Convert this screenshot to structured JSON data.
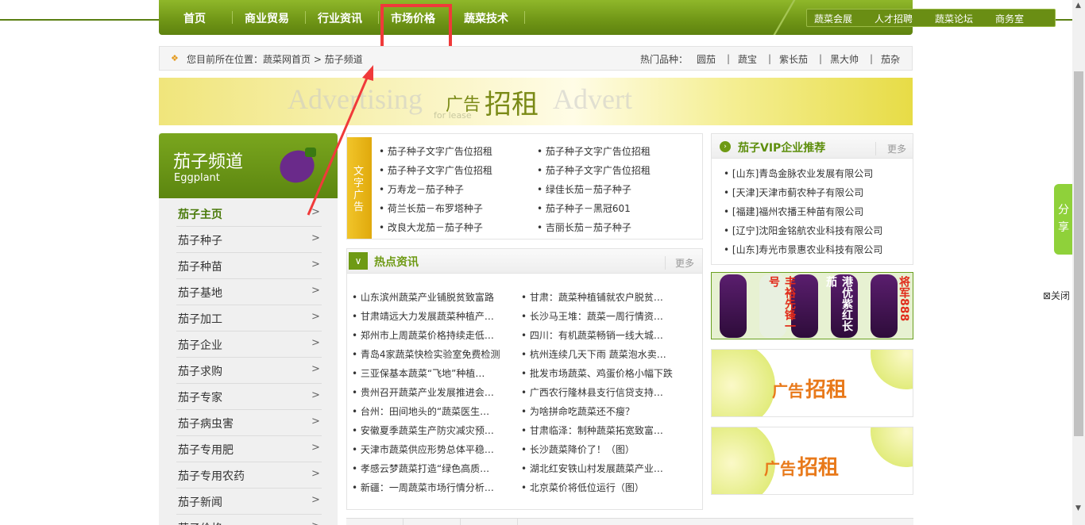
{
  "nav": {
    "items": [
      "首页",
      "商业贸易",
      "行业资讯",
      "市场价格",
      "蔬菜技术"
    ],
    "sub_items": [
      "蔬菜会展",
      "人才招聘",
      "蔬菜论坛",
      "商务室"
    ]
  },
  "breadcrumb": {
    "location": "您目前所在位置：蔬菜网首页 > 茄子频道",
    "hot_label": "热门品种：",
    "hot_varieties": [
      "圆茄",
      "蔬宝",
      "紫长茄",
      "黑大帅",
      "茄杂"
    ]
  },
  "banner": {
    "ghost_left": "Advertising",
    "ghost_right": "Advert",
    "ad_small": "广告",
    "ad_big": "招租",
    "for_lease": "for lease"
  },
  "left_channel": {
    "title": "茄子频道",
    "subtitle": "Eggplant",
    "items": [
      "茄子主页",
      "茄子种子",
      "茄子种苗",
      "茄子基地",
      "茄子加工",
      "茄子企业",
      "茄子求购",
      "茄子专家",
      "茄子病虫害",
      "茄子专用肥",
      "茄子专用农药",
      "茄子新闻",
      "茄子价格"
    ],
    "arrow": ">"
  },
  "text_ads": {
    "tag": "文字广告",
    "left": [
      "茄子种子文字广告位招租",
      "茄子种子文字广告位招租",
      "万寿龙－茄子种子",
      "荷兰长茄－布罗塔种子",
      "改良大龙茄－茄子种子"
    ],
    "right": [
      "茄子种子文字广告位招租",
      "茄子种子文字广告位招租",
      "绿佳长茄－茄子种子",
      "茄子种子－黑冠601",
      "吉丽长茄－茄子种子"
    ]
  },
  "hot_news": {
    "title": "热点资讯",
    "more": "更多",
    "left": [
      "山东滨州蔬菜产业铺脱贫致富路",
      "甘肃靖远大力发展蔬菜种植产…",
      "郑州市上周蔬菜价格持续走低…",
      "青岛4家蔬菜快检实验室免费检测",
      "三亚保基本蔬菜“飞地”种植…",
      "贵州召开蔬菜产业发展推进会…",
      "台州：田间地头的“蔬菜医生…",
      "安徽夏季蔬菜生产防灾减灾预…",
      "天津市蔬菜供应形势总体平稳…",
      "孝感云梦蔬菜打造“绿色高质…",
      "新疆：一周蔬菜市场行情分析…"
    ],
    "right": [
      "甘肃：蔬菜种植铺就农户脱贫…",
      "长沙马王堆：蔬菜一周行情资…",
      "四川：有机蔬菜畅销一线大城…",
      "杭州连续几天下雨 蔬菜泡水卖…",
      "批发市场蔬菜、鸡蛋价格小幅下跌",
      "广西农行隆林县支行信贷支持…",
      "为啥拼命吃蔬菜还不瘦？",
      "甘肃临泽：制种蔬菜拓宽致富…",
      "长沙蔬菜降价了！（图）",
      "湖北红安铁山村发展蔬菜产业…",
      "北京菜价将低位运行（图）"
    ]
  },
  "vip": {
    "title": "茄子VIP企业推荐",
    "more": "更多",
    "companies": [
      "[山东]青岛金脉农业发展有限公司",
      "[天津]天津市蓟农种子有限公司",
      "[福建]福州农播王种苗有限公司",
      "[辽宁]沈阳金铭航农业科技有限公司",
      "[山东]寿光市景惠农业科技有限公司"
    ]
  },
  "product_ad": {
    "labels": [
      "丰裕先锋一号",
      "港优紫红长茄",
      "将军888"
    ]
  },
  "ad_boxes": [
    {
      "small": "广告",
      "big": "招租"
    },
    {
      "small": "广告",
      "big": "招租"
    }
  ],
  "share": {
    "c1": "分",
    "c2": "享"
  },
  "close_label": "⊠关闭",
  "colors": {
    "nav_green": "#6f9516",
    "accent_orange": "#e8791a",
    "highlight_red": "#f03a3a"
  }
}
